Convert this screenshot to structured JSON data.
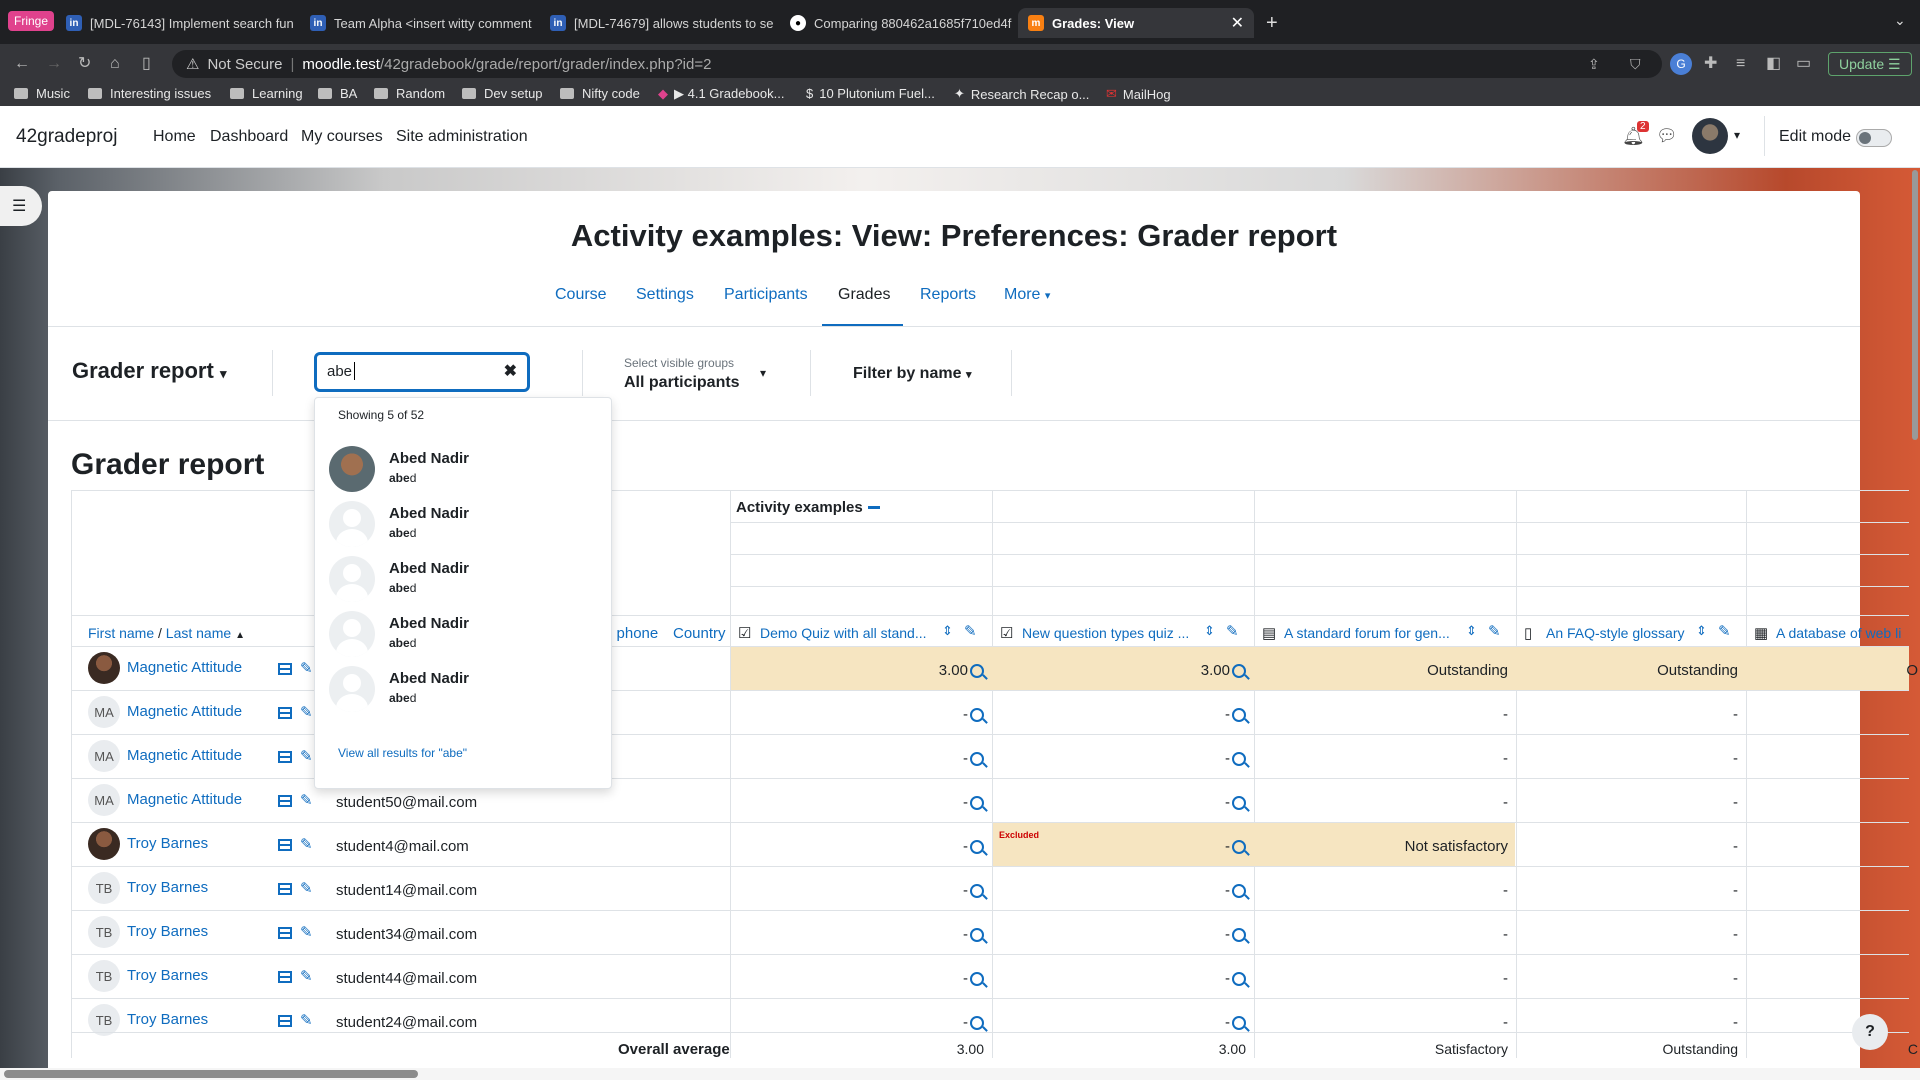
{
  "browser": {
    "profile": "Fringe",
    "tabs": [
      {
        "label": "[MDL-76143] Implement search fun",
        "icon": "jira-icon"
      },
      {
        "label": "Team Alpha <insert witty comment",
        "icon": "jira-icon"
      },
      {
        "label": "[MDL-74679] allows students to se",
        "icon": "jira-icon"
      },
      {
        "label": "Comparing 880462a1685f710ed4f",
        "icon": "github-icon"
      },
      {
        "label": "Grades: View",
        "icon": "moodle-icon"
      }
    ],
    "security": "Not Secure",
    "url_host": "moodle.test",
    "url_path": "/42gradebook/grade/report/grader/index.php?id=2",
    "update_label": "Update",
    "bookmarks": [
      "Music",
      "Interesting issues",
      "Learning",
      "BA",
      "Random",
      "Dev setup",
      "Nifty code",
      "▶ 4.1 Gradebook...",
      "10 Plutonium Fuel...",
      "Research Recap o...",
      "MailHog"
    ]
  },
  "moodle": {
    "site_name": "42gradeproj",
    "nav": [
      "Home",
      "Dashboard",
      "My courses",
      "Site administration"
    ],
    "notification_count": "2",
    "edit_mode": "Edit mode"
  },
  "page": {
    "title": "Activity examples: View: Preferences: Grader report",
    "tabs": [
      "Course",
      "Settings",
      "Participants",
      "Grades",
      "Reports",
      "More"
    ],
    "active_tab": "Grades",
    "report_selector": "Grader report",
    "search_value": "abe",
    "groups_label": "Select visible groups",
    "groups_value": "All participants",
    "filter_label": "Filter by name",
    "heading": "Grader report"
  },
  "dropdown": {
    "summary": "Showing 5 of 52",
    "results": [
      {
        "name": "Abed Nadir",
        "match": "abe",
        "rest": "d"
      },
      {
        "name": "Abed Nadir",
        "match": "abe",
        "rest": "d"
      },
      {
        "name": "Abed Nadir",
        "match": "abe",
        "rest": "d"
      },
      {
        "name": "Abed Nadir",
        "match": "abe",
        "rest": "d"
      },
      {
        "name": "Abed Nadir",
        "match": "abe",
        "rest": "d"
      }
    ],
    "view_all": "View all results for \"abe\""
  },
  "table": {
    "category": "Activity examples",
    "first_name": "First name",
    "sep": "/",
    "last_name": "Last name",
    "phone_header": "e phone",
    "country_header": "Country",
    "columns": [
      "Demo Quiz with all stand...",
      "New question types quiz ...",
      "A standard forum for gen...",
      "An FAQ-style glossary",
      "A database of web li"
    ],
    "rows": [
      {
        "initials": "",
        "name": "Magnetic Attitude",
        "email": "",
        "g": [
          "3.00",
          "3.00",
          "Outstanding",
          "Outstanding",
          "O"
        ],
        "photo": true
      },
      {
        "initials": "MA",
        "name": "Magnetic Attitude",
        "email": "",
        "g": [
          "-",
          "-",
          "-",
          "-",
          ""
        ]
      },
      {
        "initials": "MA",
        "name": "Magnetic Attitude",
        "email": "",
        "g": [
          "-",
          "-",
          "-",
          "-",
          ""
        ]
      },
      {
        "initials": "MA",
        "name": "Magnetic Attitude",
        "email": "student50@mail.com",
        "g": [
          "-",
          "-",
          "-",
          "-",
          ""
        ]
      },
      {
        "initials": "",
        "name": "Troy Barnes",
        "email": "student4@mail.com",
        "g": [
          "-",
          "-",
          "Not satisfactory",
          "-",
          ""
        ],
        "photo": true,
        "excluded": "Excluded"
      },
      {
        "initials": "TB",
        "name": "Troy Barnes",
        "email": "student14@mail.com",
        "g": [
          "-",
          "-",
          "-",
          "-",
          ""
        ]
      },
      {
        "initials": "TB",
        "name": "Troy Barnes",
        "email": "student34@mail.com",
        "g": [
          "-",
          "-",
          "-",
          "-",
          ""
        ]
      },
      {
        "initials": "TB",
        "name": "Troy Barnes",
        "email": "student44@mail.com",
        "g": [
          "-",
          "-",
          "-",
          "-",
          ""
        ]
      },
      {
        "initials": "TB",
        "name": "Troy Barnes",
        "email": "student24@mail.com",
        "g": [
          "-",
          "-",
          "-",
          "-",
          ""
        ]
      }
    ],
    "overall_label": "Overall average",
    "overall": [
      "3.00",
      "3.00",
      "Satisfactory",
      "Outstanding",
      "C"
    ]
  },
  "help": "?"
}
